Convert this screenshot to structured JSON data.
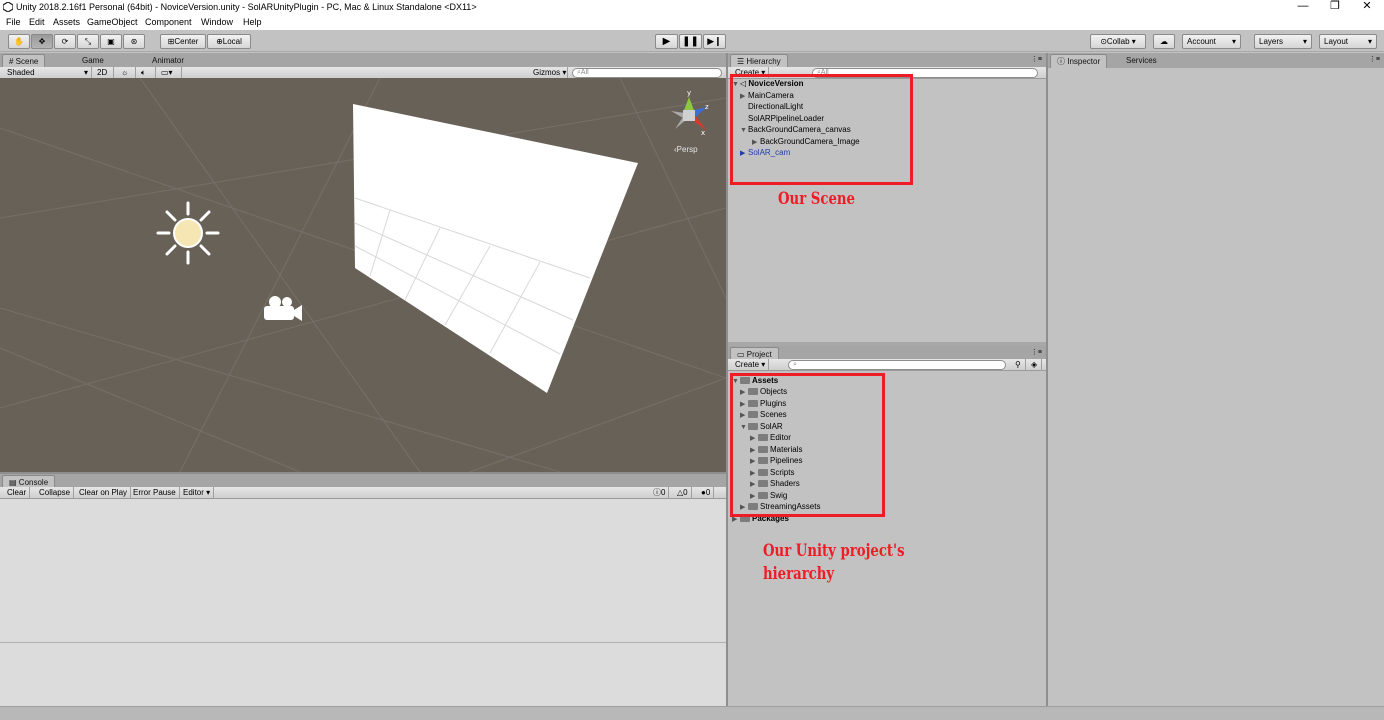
{
  "window": {
    "title": "Unity 2018.2.16f1 Personal (64bit) - NoviceVersion.unity - SolARUnityPlugin - PC, Mac & Linux Standalone <DX11>",
    "minimize": "—",
    "restore": "❐",
    "close": "✕"
  },
  "menu": [
    "File",
    "Edit",
    "Assets",
    "GameObject",
    "Component",
    "Window",
    "Help"
  ],
  "toolbar": {
    "center_label": "Center",
    "local_label": "Local",
    "collab_label": "Collab ▾",
    "account_label": "Account",
    "layers_label": "Layers",
    "layout_label": "Layout"
  },
  "scene_panel": {
    "tabs": [
      "# Scene",
      "Game",
      "Animator"
    ],
    "shading_mode": "Shaded",
    "mode_2d": "2D",
    "gizmos_label": "Gizmos",
    "search_placeholder": "All",
    "persp_label": "Persp"
  },
  "hierarchy": {
    "tab": "Hierarchy",
    "create_label": "Create",
    "search_placeholder": "All",
    "scene_name": "NoviceVersion",
    "items": [
      {
        "label": "MainCamera"
      },
      {
        "label": "DirectionalLight"
      },
      {
        "label": "SolARPipelineLoader"
      },
      {
        "label": "BackGroundCamera_canvas"
      },
      {
        "label": "BackGroundCamera_Image"
      },
      {
        "label": "SolAR_cam"
      }
    ]
  },
  "project": {
    "tab": "Project",
    "create_label": "Create",
    "items": [
      {
        "label": "Assets"
      },
      {
        "label": "Objects"
      },
      {
        "label": "Plugins"
      },
      {
        "label": "Scenes"
      },
      {
        "label": "SolAR"
      },
      {
        "label": "Editor"
      },
      {
        "label": "Materials"
      },
      {
        "label": "Pipelines"
      },
      {
        "label": "Scripts"
      },
      {
        "label": "Shaders"
      },
      {
        "label": "Swig"
      },
      {
        "label": "StreamingAssets"
      },
      {
        "label": "Packages"
      }
    ]
  },
  "inspector": {
    "tabs": [
      "Inspector",
      "Services"
    ]
  },
  "console": {
    "tab": "Console",
    "buttons": [
      "Clear",
      "Collapse",
      "Clear on Play",
      "Error Pause",
      "Editor"
    ],
    "counts": [
      "0",
      "0",
      "0"
    ]
  },
  "annotations": {
    "scene": "Our Scene",
    "project_line1": "Our Unity project's",
    "project_line2": "hierarchy",
    "color": "#ee1c24"
  }
}
